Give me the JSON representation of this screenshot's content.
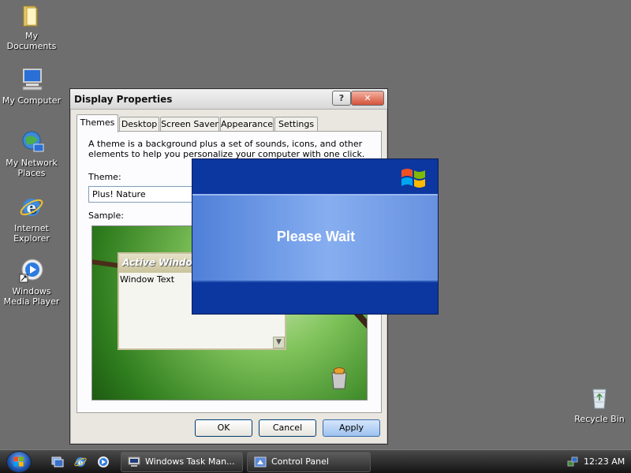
{
  "desktop": {
    "icons": [
      {
        "label": "My Documents",
        "icon": "folder-icon"
      },
      {
        "label": "My Computer",
        "icon": "computer-icon"
      },
      {
        "label": "My Network Places",
        "icon": "network-icon"
      },
      {
        "label": "Internet Explorer",
        "icon": "internet-explorer-icon"
      },
      {
        "label": "Windows Media Player",
        "icon": "media-player-icon"
      },
      {
        "label": "Recycle Bin",
        "icon": "recycle-bin-icon"
      }
    ]
  },
  "dialog": {
    "title": "Display Properties",
    "help_label": "?",
    "close_label": "✕",
    "tabs": [
      "Themes",
      "Desktop",
      "Screen Saver",
      "Appearance",
      "Settings"
    ],
    "active_tab": "Themes",
    "description": "A theme is a background plus a set of sounds, icons, and other elements to help you personalize your computer with one click.",
    "theme_label": "Theme:",
    "theme_value": "Plus! Nature",
    "sample_label": "Sample:",
    "sample": {
      "window_title": "Active Window",
      "window_text": "Window Text"
    },
    "buttons": {
      "ok": "OK",
      "cancel": "Cancel",
      "apply": "Apply"
    }
  },
  "splash": {
    "text": "Please Wait"
  },
  "taskbar": {
    "tasks": [
      "Windows Task Man...",
      "Control Panel"
    ],
    "clock": "12:23 AM"
  },
  "colors": {
    "desktop": "#6e6e6e",
    "splash_blue": "#0c37a0",
    "apply_accent": "#9ec2f0"
  }
}
